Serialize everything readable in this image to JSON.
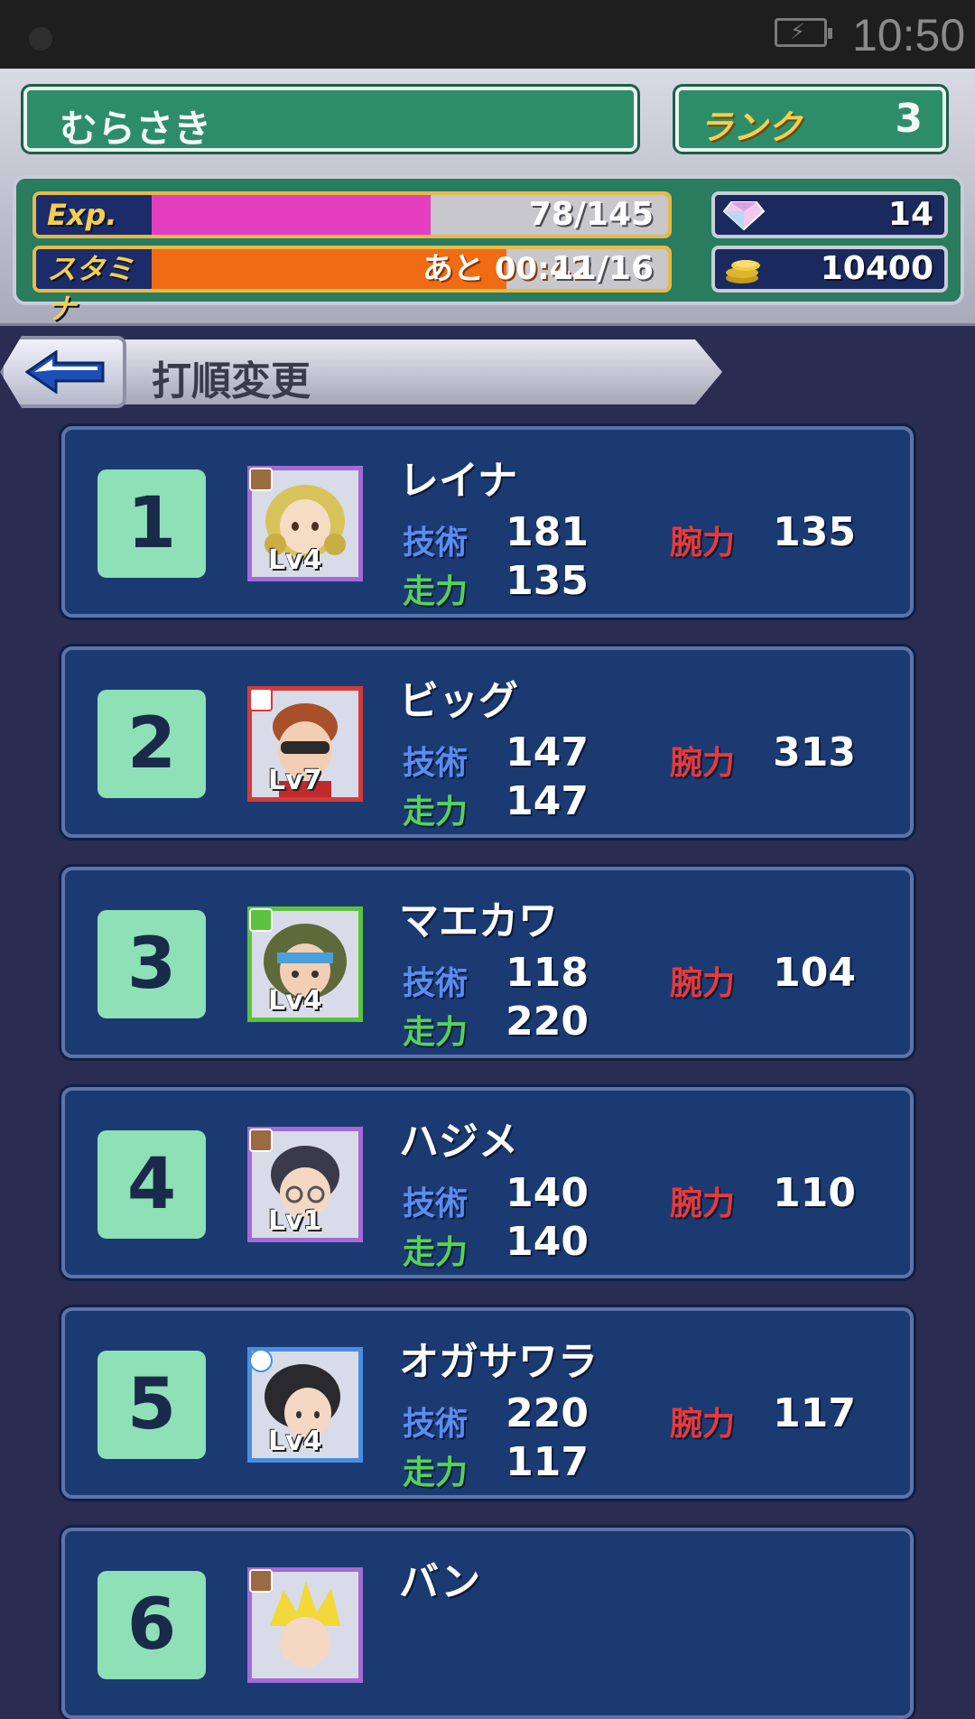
{
  "status_bar": {
    "time": "10:50"
  },
  "header": {
    "username": "むらさき",
    "rank_label": "ランク",
    "rank_value": "3",
    "exp_label": "Exp.",
    "exp_value": "78/145",
    "exp_fraction": 0.54,
    "stamina_label": "スタミナ",
    "stamina_timer": "あと 00:42",
    "stamina_value": "11/16",
    "stamina_fraction": 0.6875,
    "gems": "14",
    "coins": "10400"
  },
  "page": {
    "title": "打順変更"
  },
  "stat_labels": {
    "tech": "技術",
    "run": "走力",
    "power": "腕力"
  },
  "players": [
    {
      "order": "1",
      "name": "レイナ",
      "level": "Lv4",
      "tech": "181",
      "power": "135",
      "run": "135",
      "frame": "purple"
    },
    {
      "order": "2",
      "name": "ビッグ",
      "level": "Lv7",
      "tech": "147",
      "power": "313",
      "run": "147",
      "frame": "red"
    },
    {
      "order": "3",
      "name": "マエカワ",
      "level": "Lv4",
      "tech": "118",
      "power": "104",
      "run": "220",
      "frame": "green"
    },
    {
      "order": "4",
      "name": "ハジメ",
      "level": "Lv1",
      "tech": "140",
      "power": "110",
      "run": "140",
      "frame": "purple"
    },
    {
      "order": "5",
      "name": "オガサワラ",
      "level": "Lv4",
      "tech": "220",
      "power": "117",
      "run": "117",
      "frame": "blue"
    },
    {
      "order": "6",
      "name": "バン",
      "level": "",
      "tech": "",
      "power": "",
      "run": "",
      "frame": "purple"
    }
  ]
}
